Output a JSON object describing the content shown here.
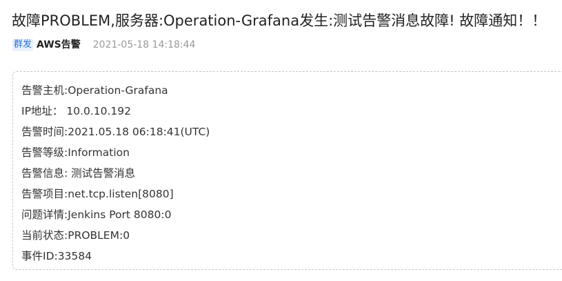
{
  "message": {
    "title": "故障PROBLEM,服务器:Operation-Grafana发生:测试告警消息故障! 故障通知！！",
    "tag": "群发",
    "sender": "AWS告警",
    "timestamp": "2021-05-18 14:18:44",
    "body_lines": [
      "告警主机:Operation-Grafana",
      "IP地址： 10.0.10.192",
      "告警时间:2021.05.18 06:18:41(UTC)",
      "告警等级:Information",
      "告警信息: 测试告警消息",
      "告警项目:net.tcp.listen[8080]",
      "问题详情:Jenkins Port 8080:0",
      "当前状态:PROBLEM:0",
      "事件ID:33584"
    ]
  }
}
